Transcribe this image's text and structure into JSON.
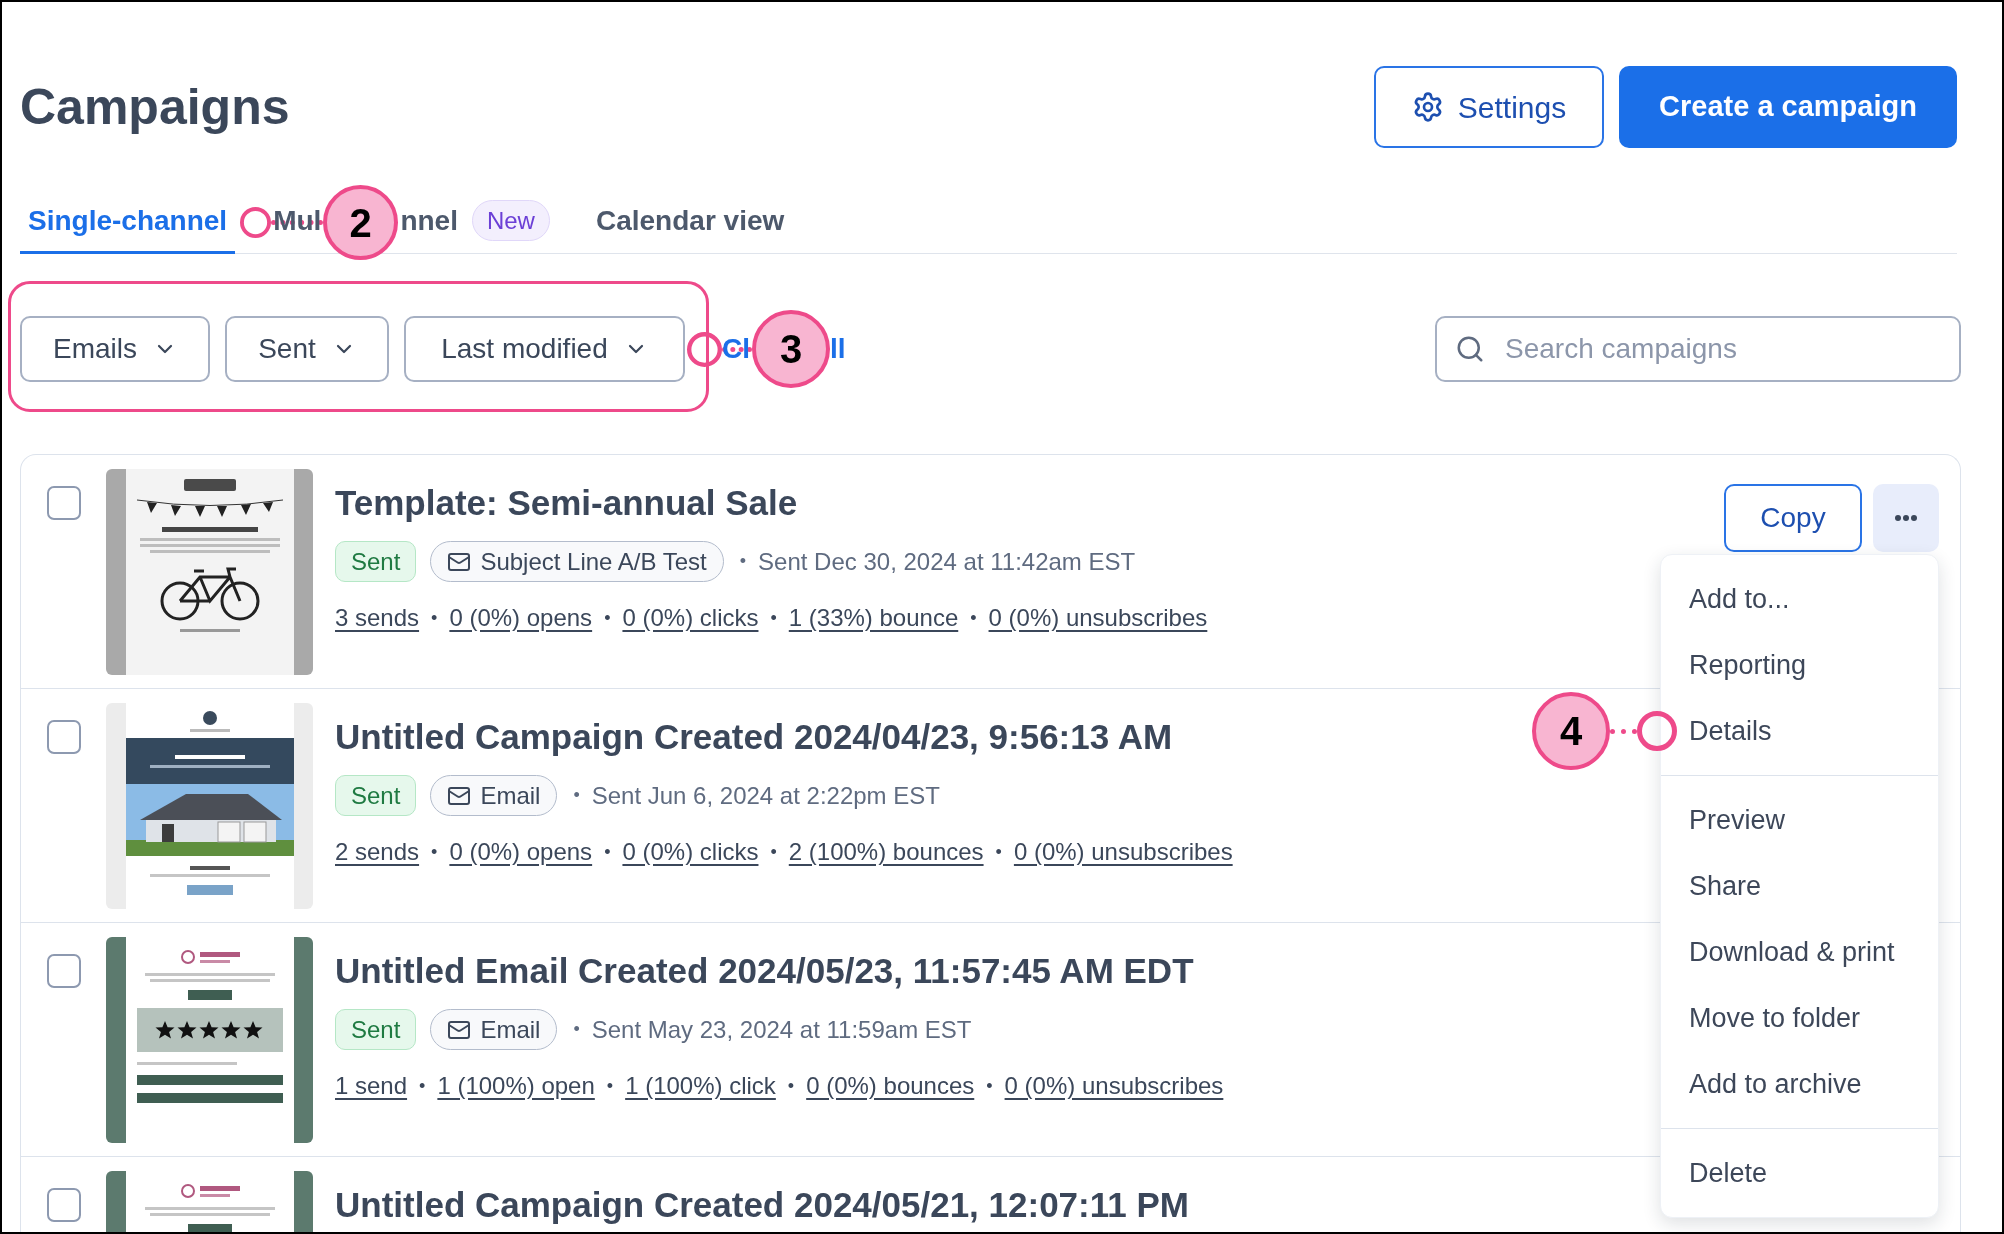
{
  "page": {
    "title": "Campaigns"
  },
  "header_actions": {
    "settings": "Settings",
    "create": "Create a campaign"
  },
  "tabs": {
    "callout": "2",
    "items": [
      {
        "label_parts": [
          "Single-channel"
        ],
        "selected": true
      },
      {
        "label_parts": [
          "Mul",
          "nnel"
        ],
        "selected": false,
        "badge": "New"
      },
      {
        "label_parts": [
          "Calendar view"
        ],
        "selected": false
      }
    ]
  },
  "filters": {
    "highlighted": true,
    "callout": "3",
    "dropdowns": [
      {
        "label": "Emails"
      },
      {
        "label": "Sent"
      },
      {
        "label": "Last modified"
      }
    ],
    "clear_link_parts": [
      "Cl",
      "ll"
    ],
    "search": {
      "placeholder": "Search campaigns"
    }
  },
  "campaigns": {
    "separator": "•",
    "rows": [
      {
        "checked": false,
        "thumbnail": {
          "kind": "bike"
        },
        "title": "Template: Semi-annual Sale",
        "status": "Sent",
        "channel": "Subject Line A/B Test",
        "sent_info": "Sent Dec 30, 2024 at 11:42am EST",
        "stats": [
          "3 sends",
          "0 (0%) opens",
          "0 (0%) clicks",
          "1 (33%) bounce",
          "0 (0%) unsubscribes"
        ],
        "actions": {
          "copy": "Copy",
          "more_expanded": true,
          "menu": [
            [
              {
                "label": "Add to..."
              },
              {
                "label": "Reporting"
              },
              {
                "label": "Details",
                "callout": "4"
              }
            ],
            [
              {
                "label": "Preview"
              },
              {
                "label": "Share"
              },
              {
                "label": "Download & print"
              },
              {
                "label": "Move to folder"
              },
              {
                "label": "Add to archive"
              }
            ],
            [
              {
                "label": "Delete"
              }
            ]
          ]
        }
      },
      {
        "checked": false,
        "thumbnail": {
          "kind": "house"
        },
        "title": "Untitled Campaign Created 2024/04/23, 9:56:13 AM",
        "status": "Sent",
        "channel": "Email",
        "sent_info": "Sent Jun 6, 2024 at 2:22pm EST",
        "stats": [
          "2 sends",
          "0 (0%) opens",
          "0 (0%) clicks",
          "2 (100%) bounces",
          "0 (0%) unsubscribes"
        ]
      },
      {
        "checked": false,
        "thumbnail": {
          "kind": "florist"
        },
        "title": "Untitled Email Created 2024/05/23, 11:57:45 AM EDT",
        "status": "Sent",
        "channel": "Email",
        "sent_info": "Sent May 23, 2024 at 11:59am EST",
        "stats": [
          "1 send",
          "1 (100%) open",
          "1 (100%) click",
          "0 (0%) bounces",
          "0 (0%) unsubscribes"
        ]
      },
      {
        "checked": false,
        "thumbnail": {
          "kind": "florist"
        },
        "title": "Untitled Campaign Created 2024/05/21, 12:07:11 PM"
      }
    ]
  }
}
